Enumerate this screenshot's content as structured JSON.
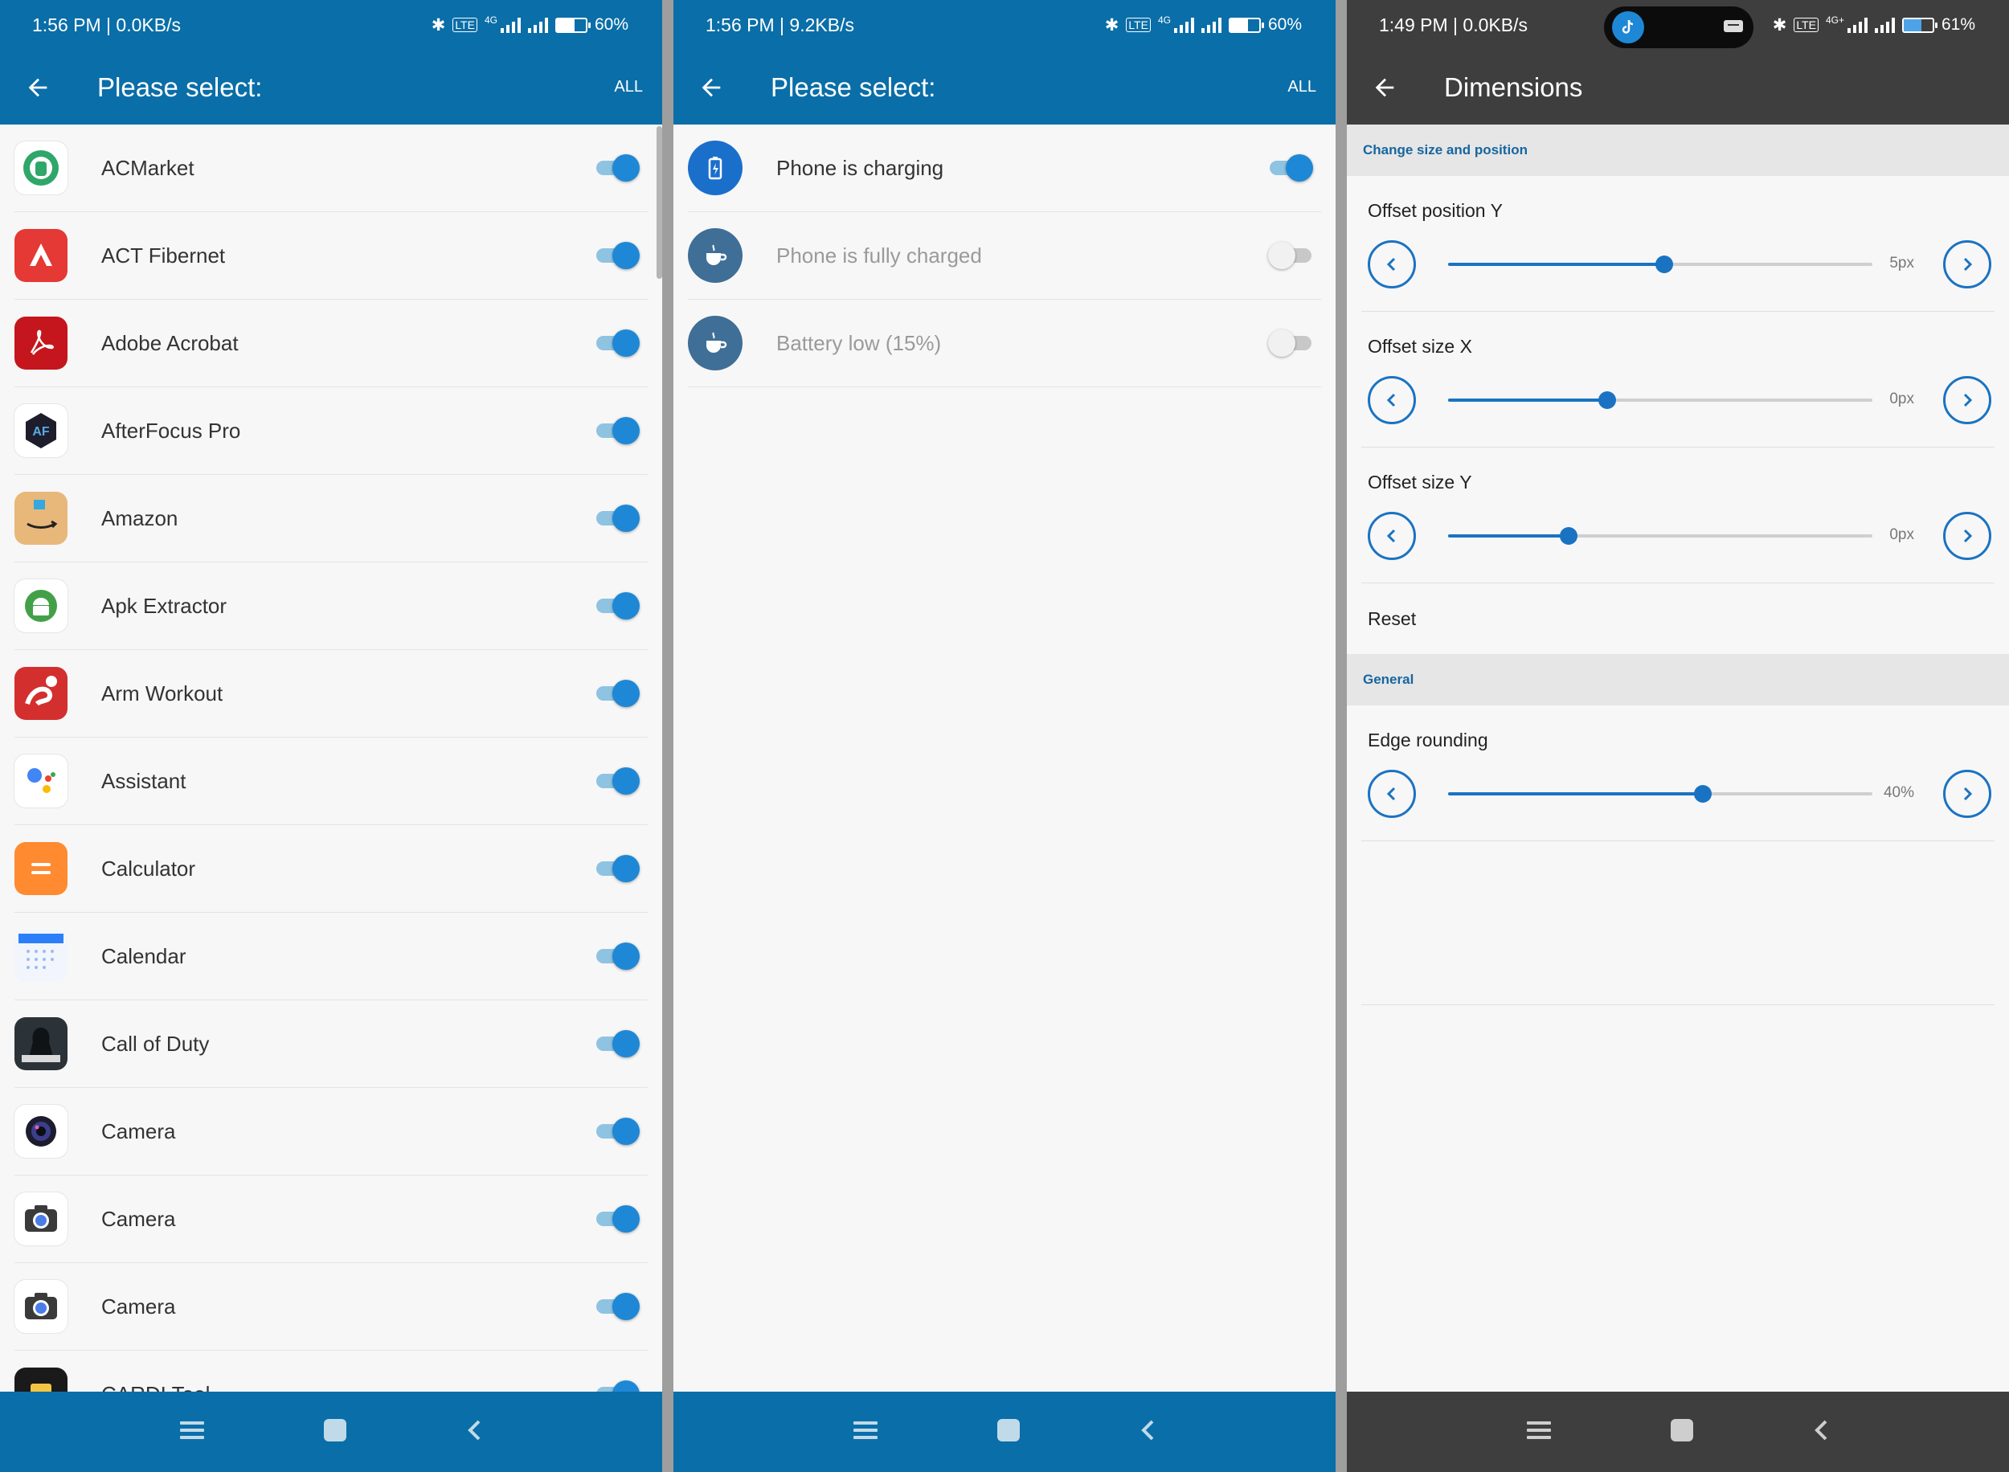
{
  "screens": [
    {
      "status": {
        "time": "1:56 PM | 0.0KB/s",
        "battery": "60%",
        "tag_4g": "4G"
      },
      "title": "Please select:",
      "action": "ALL",
      "apps": [
        {
          "name": "ACMarket",
          "icon": "acmarket-icon",
          "enabled": true
        },
        {
          "name": "ACT Fibernet",
          "icon": "act-fibernet-icon",
          "enabled": true
        },
        {
          "name": "Adobe Acrobat",
          "icon": "adobe-acrobat-icon",
          "enabled": true
        },
        {
          "name": "AfterFocus Pro",
          "icon": "afterfocus-icon",
          "enabled": true
        },
        {
          "name": "Amazon",
          "icon": "amazon-icon",
          "enabled": true
        },
        {
          "name": "Apk Extractor",
          "icon": "android-icon",
          "enabled": true
        },
        {
          "name": "Arm Workout",
          "icon": "arm-workout-icon",
          "enabled": true
        },
        {
          "name": "Assistant",
          "icon": "assistant-icon",
          "enabled": true
        },
        {
          "name": "Calculator",
          "icon": "calculator-icon",
          "enabled": true
        },
        {
          "name": "Calendar",
          "icon": "calendar-icon",
          "enabled": true
        },
        {
          "name": "Call of Duty",
          "icon": "call-of-duty-icon",
          "enabled": true
        },
        {
          "name": "Camera",
          "icon": "camera-lens-icon",
          "enabled": true
        },
        {
          "name": "Camera",
          "icon": "camera-icon",
          "enabled": true
        },
        {
          "name": "Camera",
          "icon": "camera-icon",
          "enabled": true
        },
        {
          "name": "CARDI Tool",
          "icon": "cardi-tool-icon",
          "enabled": true
        }
      ]
    },
    {
      "status": {
        "time": "1:56 PM | 9.2KB/s",
        "battery": "60%",
        "tag_4g": "4G"
      },
      "title": "Please select:",
      "action": "ALL",
      "events": [
        {
          "name": "Phone is charging",
          "icon": "battery-charging-icon",
          "enabled": true
        },
        {
          "name": "Phone is fully charged",
          "icon": "coffee-cup-icon",
          "enabled": false
        },
        {
          "name": "Battery low (15%)",
          "icon": "coffee-cup-icon",
          "enabled": false
        }
      ]
    },
    {
      "status": {
        "time": "1:49 PM | 0.0KB/s",
        "battery": "61%",
        "tag_4g": "4G+"
      },
      "title": "Dimensions",
      "section_position": "Change size and position",
      "settings": [
        {
          "label": "Offset position Y",
          "value": "5px",
          "fraction": 0.51
        },
        {
          "label": "Offset size X",
          "value": "0px",
          "fraction": 0.375
        },
        {
          "label": "Offset size Y",
          "value": "0px",
          "fraction": 0.285
        }
      ],
      "reset": "Reset",
      "section_general": "General",
      "general": [
        {
          "label": "Edge rounding",
          "value": "40%",
          "fraction": 0.6
        }
      ]
    }
  ],
  "colors": {
    "primary": "#0a6ea8",
    "accent": "#1e88d6",
    "dark_bar": "#3e3e3e"
  }
}
